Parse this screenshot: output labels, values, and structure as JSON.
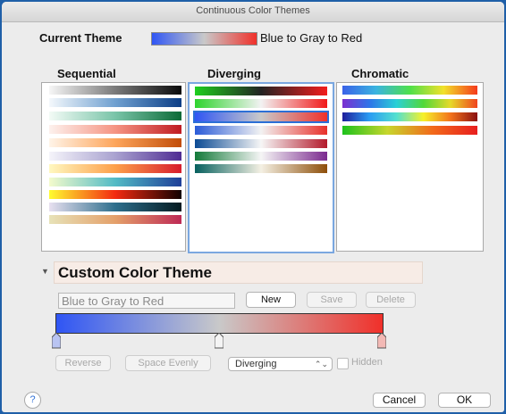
{
  "window": {
    "title": "Continuous Color Themes"
  },
  "current_theme": {
    "label": "Current Theme",
    "name": "Blue to Gray to Red"
  },
  "columns": [
    {
      "title": "Sequential"
    },
    {
      "title": "Diverging"
    },
    {
      "title": "Chromatic"
    }
  ],
  "selected_theme": "Blue to Gray to Red",
  "custom": {
    "header": "Custom Color Theme",
    "name_value": "Blue to Gray to Red",
    "new_label": "New",
    "save_label": "Save",
    "delete_label": "Delete",
    "reverse_label": "Reverse",
    "space_evenly_label": "Space Evenly",
    "type_value": "Diverging",
    "hidden_label": "Hidden",
    "hidden_checked": false,
    "gradient_colors": [
      "#2f55f4",
      "#c9c9c9",
      "#f0302a"
    ]
  },
  "footer": {
    "help": "?",
    "cancel_label": "Cancel",
    "ok_label": "OK"
  },
  "colors": {
    "selection_blue": "#2c6fd6",
    "window_bg": "#ececec"
  },
  "icons": {
    "collapse": "disclosure-triangle-down-icon",
    "help": "question-mark-icon"
  }
}
